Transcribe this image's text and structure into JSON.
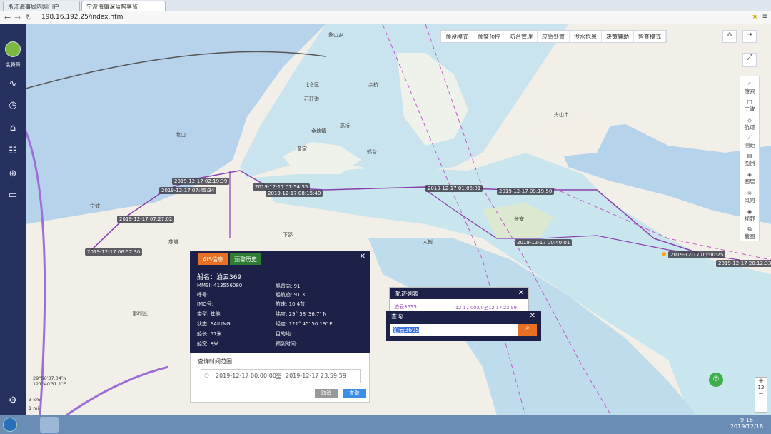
{
  "browser": {
    "tabs": [
      "浙江海事局内网门户",
      "宁波海事深蓝智享监"
    ],
    "url": "198.16.192.25/index.html"
  },
  "sidebar": {
    "user": "余腾哥"
  },
  "topnav": [
    "预设模式",
    "预警预控",
    "防台管理",
    "应急处置",
    "涉水危患",
    "决策辅助",
    "智查模式"
  ],
  "tools": [
    "搜索",
    "宁波",
    "航道",
    "测距",
    "图例",
    "图层",
    "风向",
    "视野",
    "截图"
  ],
  "track_labels": [
    "2019-12-17 06:57:30",
    "2019-12-17 07:27:02",
    "2019-12-17 07:45:34",
    "2019-12-17 02:19:39",
    "2019-12-17 01:54:35",
    "2019-12-17 08:15:40",
    "2019-12-17 01:05:01",
    "2019-12-17 09:19:50",
    "2019-12-17 00:40:01",
    "2019-12-17 00:00:25",
    "2019-12-17 20:12:33"
  ],
  "places": [
    "象山乡",
    "北仑区",
    "石矸港",
    "余杭",
    "舟山市",
    "金塘镇",
    "高桥",
    "鹤台",
    "长安",
    "下邵",
    "大榭",
    "鄞州区",
    "宁波",
    "龙山",
    "慈城",
    "黄家"
  ],
  "info": {
    "tab_ais": "AIS信息",
    "tab_alarm": "预警历史",
    "title": "船名：泊云369",
    "mmsi": "MMSI: 413556080",
    "callsign": "呼号:",
    "imo": "IMO号:",
    "type": "类型: 其他",
    "status": "状态: SAILING",
    "length": "船长: 57米",
    "width": "船宽: 8米",
    "heading": "船首向: 91",
    "course": "船航迹: 91.3",
    "speed": "航速: 10.4节",
    "lat": "纬度: 29° 58′ 36.7″ N",
    "lon": "经度: 121° 45′ 50.19″ E",
    "dest": "目的地:",
    "eta": "预到时间:"
  },
  "range": {
    "title": "查询时间范围",
    "start": "2019-12-17 00:00:00",
    "to": "至",
    "end": "2019-12-17 23:59:59",
    "cancel": "取消",
    "confirm": "查询"
  },
  "tracklist": {
    "title": "轨迹列表",
    "ship": "泊云3695",
    "time": "12-17 00:00至12-17 23:59"
  },
  "query": {
    "title": "查询",
    "value": "泊云3695"
  },
  "scale": {
    "coord1": "29°50′37.04″N",
    "coord2": "121°40′31.1″E",
    "s1": "3 km",
    "s2": "1 mi",
    "zoom": "12"
  },
  "taskbar": {
    "time": "9:16",
    "date": "2019/12/18"
  },
  "colors": {
    "sea": "#bcd6ea",
    "sidebar": "#27315f",
    "panel": "#1d2148",
    "orange": "#e96f22",
    "track": "#8b3fae"
  }
}
